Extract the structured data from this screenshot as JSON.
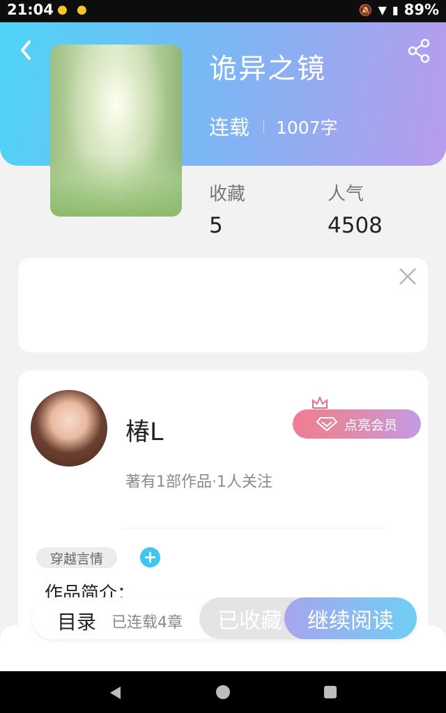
{
  "status_bar": {
    "time": "21:04",
    "battery": "89%"
  },
  "book": {
    "title": "诡异之镜",
    "state": "连载",
    "word_count": "1007字",
    "stats": {
      "collect_label": "收藏",
      "collect_value": "5",
      "popularity_label": "人气",
      "popularity_value": "4508"
    }
  },
  "author": {
    "name": "椿L",
    "info": "著有1部作品·1人关注",
    "vip_button": "点亮会员"
  },
  "tags": [
    "穿越言情"
  ],
  "intro_label": "作品简介：",
  "action_bar": {
    "toc_label": "目录",
    "chapters_label": "已连载4章",
    "collected_label": "已收藏",
    "read_label": "继续阅读"
  },
  "icons": {
    "back": "chevron-left-icon",
    "share": "share-icon",
    "close": "close-icon",
    "crown": "crown-icon",
    "diamond": "diamond-icon",
    "add": "plus-icon"
  },
  "colors": {
    "header_gradient_start": "#4fd4f7",
    "header_gradient_end": "#b89bec",
    "vip_start": "#f07d93",
    "vip_end": "#c49ae6",
    "read_start": "#a7a5ee",
    "read_end": "#6fcff4"
  }
}
